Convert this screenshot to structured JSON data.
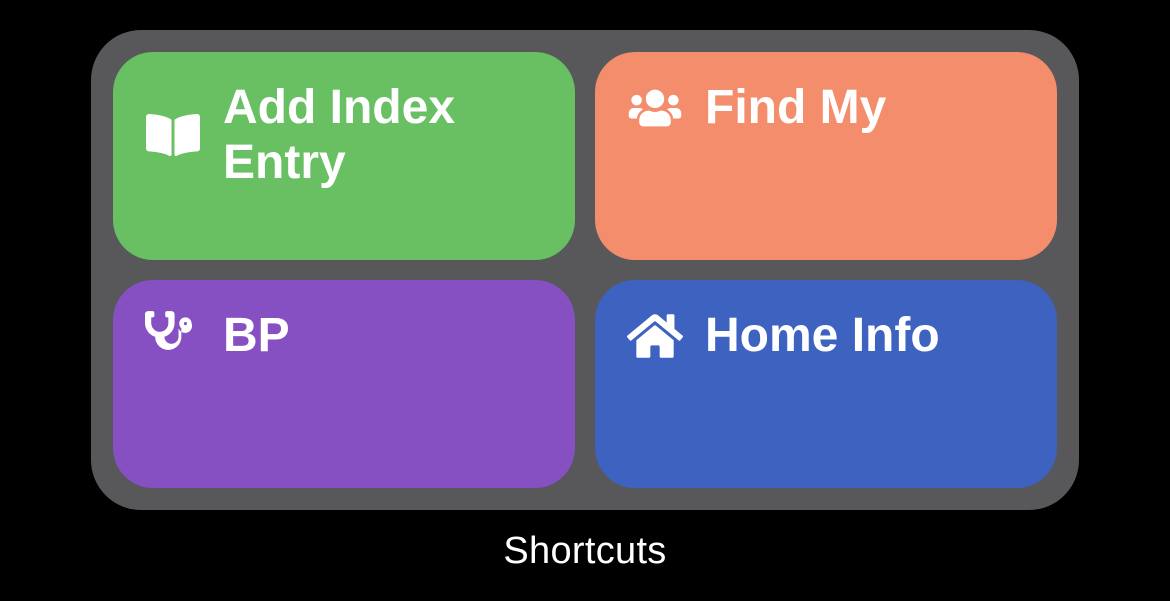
{
  "widget": {
    "title": "Shortcuts",
    "shortcuts": [
      {
        "label": "Add Index Entry",
        "icon": "book",
        "color": "green"
      },
      {
        "label": "Find My",
        "icon": "people",
        "color": "orange"
      },
      {
        "label": "BP",
        "icon": "stethoscope",
        "color": "purple"
      },
      {
        "label": "Home Info",
        "icon": "house",
        "color": "blue"
      }
    ]
  }
}
